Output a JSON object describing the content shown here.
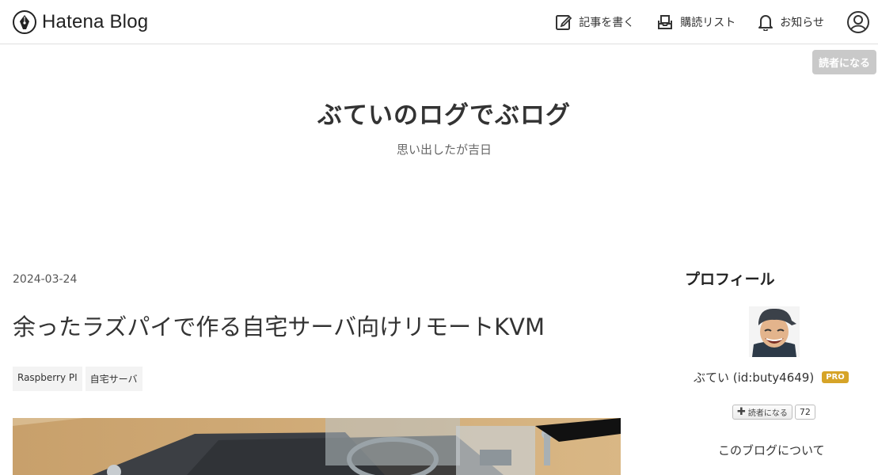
{
  "header": {
    "logo_text": "Hatena Blog",
    "nav": {
      "write_label": "記事を書く",
      "reading_list_label": "購読リスト",
      "notifications_label": "お知らせ"
    },
    "follow_label": "読者になる"
  },
  "blog": {
    "title": "ぶていのログでぶログ",
    "description": "思い出したが吉日"
  },
  "entry": {
    "date": "2024-03-24",
    "title": "余ったラズパイで作る自宅サーバ向けリモートKVM",
    "tags": [
      "Raspberry PI",
      "自宅サーバ"
    ]
  },
  "sidebar": {
    "profile_heading": "プロフィール",
    "name": "ぶてい (id:buty4649)",
    "pro_badge": "PRO",
    "subscribe_label": "読者になる",
    "subscriber_count": "72",
    "about_link": "このブログについて"
  },
  "colors": {
    "pro_badge": "#d6a428",
    "follow_button_bg": "#c9c9c9"
  }
}
